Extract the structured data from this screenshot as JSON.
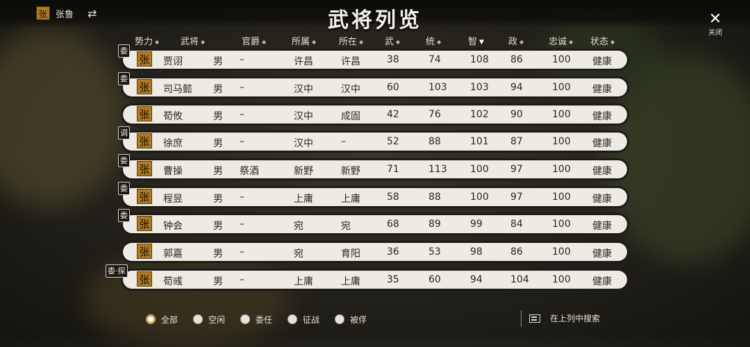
{
  "player": {
    "badge": "张",
    "name": "张鲁"
  },
  "title": "武将列览",
  "close": {
    "label": "关闭"
  },
  "columns": [
    "势力",
    "武将",
    "官爵",
    "所属",
    "所在",
    "武",
    "统",
    "智",
    "政",
    "忠诚",
    "状态"
  ],
  "rows": [
    {
      "badge": "委",
      "faction": "张",
      "name": "贾诩",
      "gender": "男",
      "rank": "–",
      "belong": "许昌",
      "at": "许昌",
      "wu": "38",
      "tong": "74",
      "zhi": "108",
      "zheng": "86",
      "loyalty": "100",
      "state": "健康"
    },
    {
      "badge": "委",
      "faction": "张",
      "name": "司马懿",
      "gender": "男",
      "rank": "–",
      "belong": "汉中",
      "at": "汉中",
      "wu": "60",
      "tong": "103",
      "zhi": "103",
      "zheng": "94",
      "loyalty": "100",
      "state": "健康"
    },
    {
      "badge": "",
      "faction": "张",
      "name": "荀攸",
      "gender": "男",
      "rank": "–",
      "belong": "汉中",
      "at": "成固",
      "wu": "42",
      "tong": "76",
      "zhi": "102",
      "zheng": "90",
      "loyalty": "100",
      "state": "健康"
    },
    {
      "badge": "调",
      "faction": "张",
      "name": "徐庶",
      "gender": "男",
      "rank": "–",
      "belong": "汉中",
      "at": "–",
      "wu": "52",
      "tong": "88",
      "zhi": "101",
      "zheng": "87",
      "loyalty": "100",
      "state": "健康"
    },
    {
      "badge": "委",
      "faction": "张",
      "name": "曹操",
      "gender": "男",
      "rank": "祭酒",
      "belong": "新野",
      "at": "新野",
      "wu": "71",
      "tong": "113",
      "zhi": "100",
      "zheng": "97",
      "loyalty": "100",
      "state": "健康"
    },
    {
      "badge": "委",
      "faction": "张",
      "name": "程昱",
      "gender": "男",
      "rank": "–",
      "belong": "上庸",
      "at": "上庸",
      "wu": "58",
      "tong": "88",
      "zhi": "100",
      "zheng": "97",
      "loyalty": "100",
      "state": "健康"
    },
    {
      "badge": "委",
      "faction": "张",
      "name": "钟会",
      "gender": "男",
      "rank": "–",
      "belong": "宛",
      "at": "宛",
      "wu": "68",
      "tong": "89",
      "zhi": "99",
      "zheng": "84",
      "loyalty": "100",
      "state": "健康"
    },
    {
      "badge": "",
      "faction": "张",
      "name": "郭嘉",
      "gender": "男",
      "rank": "–",
      "belong": "宛",
      "at": "育阳",
      "wu": "36",
      "tong": "53",
      "zhi": "98",
      "zheng": "86",
      "loyalty": "100",
      "state": "健康"
    },
    {
      "badge": "委·探",
      "faction": "张",
      "name": "荀彧",
      "gender": "男",
      "rank": "–",
      "belong": "上庸",
      "at": "上庸",
      "wu": "35",
      "tong": "60",
      "zhi": "94",
      "zheng": "104",
      "loyalty": "100",
      "state": "健康"
    }
  ],
  "filters": [
    {
      "label": "全部",
      "selected": true
    },
    {
      "label": "空闲",
      "selected": false
    },
    {
      "label": "委任",
      "selected": false
    },
    {
      "label": "征战",
      "selected": false
    },
    {
      "label": "被俘",
      "selected": false
    }
  ],
  "search": {
    "label": "在上列中搜索"
  },
  "colors": {
    "faction_gold": "#b07a22",
    "row_bg": "#eeeae4"
  }
}
